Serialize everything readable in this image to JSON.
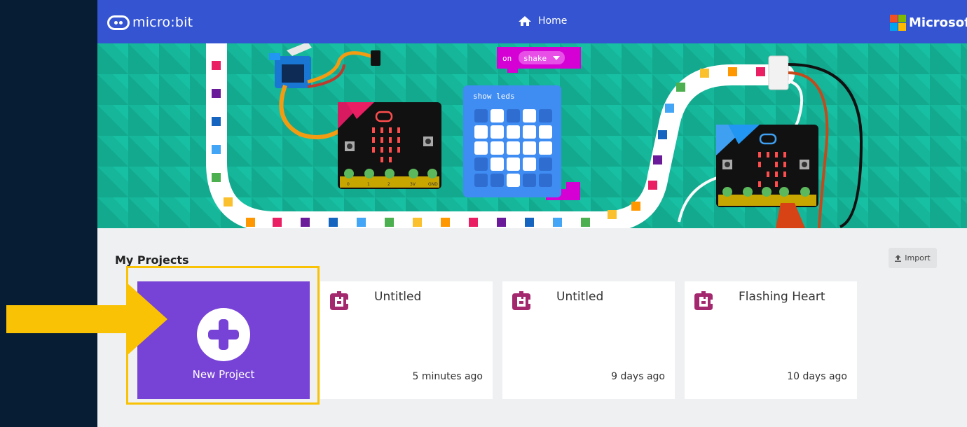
{
  "header": {
    "logo_text": "micro:bit",
    "home_label": "Home",
    "brand_label": "Microsoft",
    "brand_colors": [
      "#f25022",
      "#7fba00",
      "#00a4ef",
      "#ffb900"
    ]
  },
  "hero": {
    "block_event": "on",
    "block_event_option": "shake",
    "block_action": "show leds",
    "pins": [
      "0",
      "1",
      "2",
      "3V",
      "GND"
    ]
  },
  "projects": {
    "title": "My Projects",
    "import_label": "Import",
    "new_project_label": "New Project",
    "items": [
      {
        "name": "Untitled",
        "time": "5 minutes ago"
      },
      {
        "name": "Untitled",
        "time": "9 days ago"
      },
      {
        "name": "Flashing Heart",
        "time": "10 days ago"
      }
    ]
  },
  "colors": {
    "header_blue": "#3454d1",
    "hero_teal": "#15b69a",
    "new_project_purple": "#7742d6",
    "highlight_yellow": "#f9c205"
  }
}
